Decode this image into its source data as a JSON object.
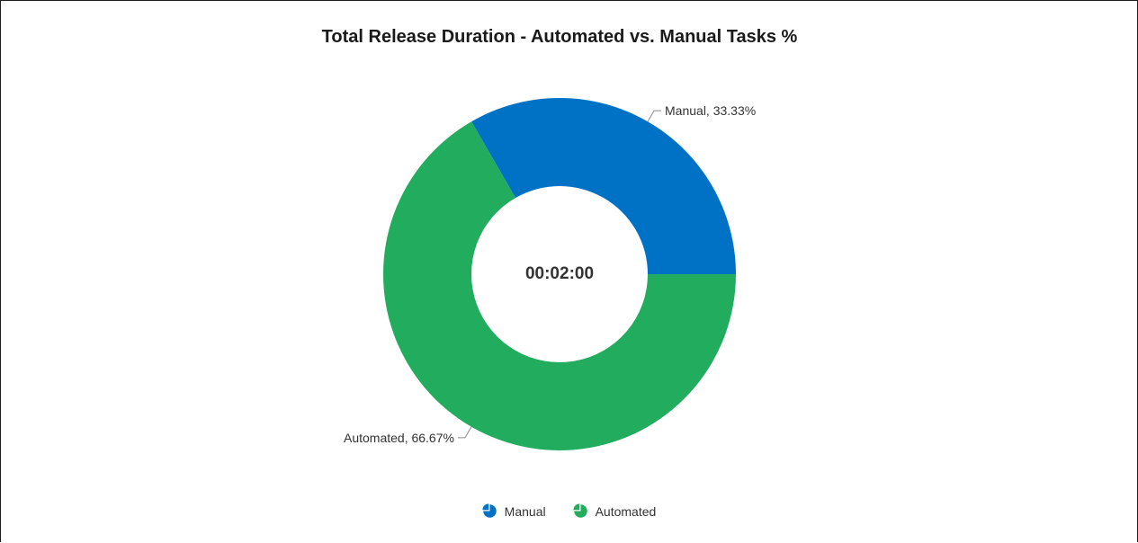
{
  "chart_data": {
    "type": "pie",
    "title": "Total Release Duration - Automated vs. Manual Tasks %",
    "center_label": "00:02:00",
    "categories": [
      "Manual",
      "Automated"
    ],
    "values": [
      33.33,
      66.67
    ],
    "colors": [
      "#0072c6",
      "#21ad5d"
    ],
    "data_labels": [
      "Manual, 33.33%",
      "Automated, 66.67%"
    ],
    "legend": {
      "position": "bottom",
      "items": [
        {
          "label": "Manual",
          "color": "#0072c6",
          "icon": "pie-chart-icon"
        },
        {
          "label": "Automated",
          "color": "#21ad5d",
          "icon": "pie-chart-icon"
        }
      ]
    },
    "donut": true
  }
}
